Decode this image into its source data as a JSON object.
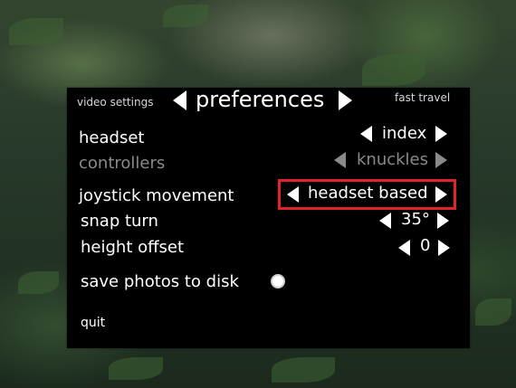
{
  "menu": {
    "left_tab": "video settings",
    "title": "preferences",
    "right_tab": "fast travel"
  },
  "settings": {
    "headset": {
      "label": "headset",
      "value": "index"
    },
    "controllers": {
      "label": "controllers",
      "value": "knuckles"
    },
    "joystick_movement": {
      "label": "joystick movement",
      "value": "headset based"
    },
    "snap_turn": {
      "label": "snap turn",
      "value": "35°"
    },
    "height_offset": {
      "label": "height offset",
      "value": "0"
    },
    "save_photos": {
      "label": "save photos to disk",
      "enabled": true
    }
  },
  "quit_label": "quit",
  "colors": {
    "panel": "#000000",
    "text": "#ffffff",
    "disabled_text": "#8a8a8a",
    "highlight": "#e0242b"
  }
}
